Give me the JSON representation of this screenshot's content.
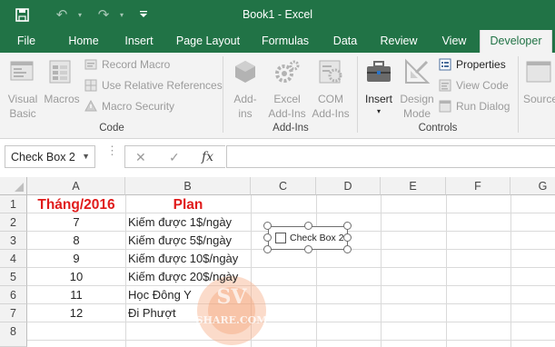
{
  "titlebar": {
    "title": "Book1 - Excel",
    "icons": [
      "save-icon",
      "undo-icon",
      "dropdown-arrow-icon",
      "redo-icon",
      "dropdown-arrow-icon",
      "customize-quick-access-icon"
    ]
  },
  "tabs": [
    "File",
    "Home",
    "Insert",
    "Page Layout",
    "Formulas",
    "Data",
    "Review",
    "View",
    "Developer"
  ],
  "active_tab": "Developer",
  "ribbon": {
    "code": {
      "label": "Code",
      "visual_basic": [
        "Visual",
        "Basic"
      ],
      "macros": "Macros",
      "record_macro": "Record Macro",
      "relative_refs": "Use Relative References",
      "macro_security": "Macro Security"
    },
    "addins": {
      "label": "Add-Ins",
      "addins": [
        "Add-",
        "ins"
      ],
      "excel_addins": [
        "Excel",
        "Add-Ins"
      ],
      "com_addins": [
        "COM",
        "Add-Ins"
      ]
    },
    "controls": {
      "label": "Controls",
      "insert": "Insert",
      "design_mode": [
        "Design",
        "Mode"
      ],
      "properties": "Properties",
      "view_code": "View Code",
      "run_dialog": "Run Dialog"
    },
    "source": "Source"
  },
  "formula_bar": {
    "name_box": "Check Box 2",
    "cancel_glyph": "✕",
    "enter_glyph": "✓",
    "fx_glyph": "fx",
    "formula": ""
  },
  "columns": [
    "A",
    "B",
    "C",
    "D",
    "E",
    "F",
    "G"
  ],
  "rows": [
    "1",
    "2",
    "3",
    "4",
    "5",
    "6",
    "7",
    "8"
  ],
  "cells": {
    "A1": "Tháng/2016",
    "B1": "Plan",
    "A2": "7",
    "B2": "Kiếm được 1$/ngày",
    "A3": "8",
    "B3": "Kiếm được 5$/ngày",
    "A4": "9",
    "B4": "Kiếm được 10$/ngày",
    "A5": "10",
    "B5": "Kiếm được 20$/ngày",
    "A6": "11",
    "B6": "Học Đông Y",
    "A7": "12",
    "B7": "Đi Phượt"
  },
  "checkbox": {
    "label": "Check Box 2",
    "checked": false
  },
  "colors": {
    "excel_green": "#217346",
    "header_red": "#e01b1b"
  }
}
